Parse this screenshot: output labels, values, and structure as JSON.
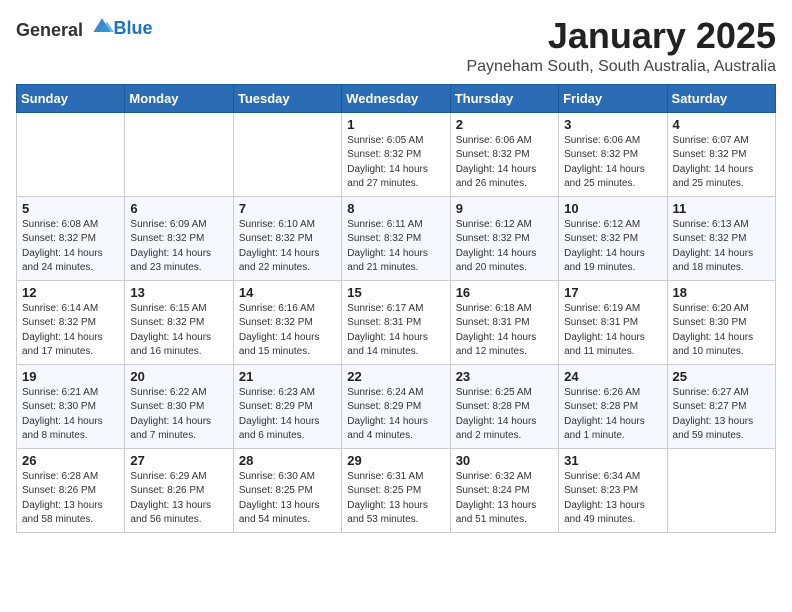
{
  "logo": {
    "general": "General",
    "blue": "Blue"
  },
  "header": {
    "month": "January 2025",
    "location": "Payneham South, South Australia, Australia"
  },
  "weekdays": [
    "Sunday",
    "Monday",
    "Tuesday",
    "Wednesday",
    "Thursday",
    "Friday",
    "Saturday"
  ],
  "weeks": [
    [
      {
        "day": "",
        "detail": ""
      },
      {
        "day": "",
        "detail": ""
      },
      {
        "day": "",
        "detail": ""
      },
      {
        "day": "1",
        "detail": "Sunrise: 6:05 AM\nSunset: 8:32 PM\nDaylight: 14 hours\nand 27 minutes."
      },
      {
        "day": "2",
        "detail": "Sunrise: 6:06 AM\nSunset: 8:32 PM\nDaylight: 14 hours\nand 26 minutes."
      },
      {
        "day": "3",
        "detail": "Sunrise: 6:06 AM\nSunset: 8:32 PM\nDaylight: 14 hours\nand 25 minutes."
      },
      {
        "day": "4",
        "detail": "Sunrise: 6:07 AM\nSunset: 8:32 PM\nDaylight: 14 hours\nand 25 minutes."
      }
    ],
    [
      {
        "day": "5",
        "detail": "Sunrise: 6:08 AM\nSunset: 8:32 PM\nDaylight: 14 hours\nand 24 minutes."
      },
      {
        "day": "6",
        "detail": "Sunrise: 6:09 AM\nSunset: 8:32 PM\nDaylight: 14 hours\nand 23 minutes."
      },
      {
        "day": "7",
        "detail": "Sunrise: 6:10 AM\nSunset: 8:32 PM\nDaylight: 14 hours\nand 22 minutes."
      },
      {
        "day": "8",
        "detail": "Sunrise: 6:11 AM\nSunset: 8:32 PM\nDaylight: 14 hours\nand 21 minutes."
      },
      {
        "day": "9",
        "detail": "Sunrise: 6:12 AM\nSunset: 8:32 PM\nDaylight: 14 hours\nand 20 minutes."
      },
      {
        "day": "10",
        "detail": "Sunrise: 6:12 AM\nSunset: 8:32 PM\nDaylight: 14 hours\nand 19 minutes."
      },
      {
        "day": "11",
        "detail": "Sunrise: 6:13 AM\nSunset: 8:32 PM\nDaylight: 14 hours\nand 18 minutes."
      }
    ],
    [
      {
        "day": "12",
        "detail": "Sunrise: 6:14 AM\nSunset: 8:32 PM\nDaylight: 14 hours\nand 17 minutes."
      },
      {
        "day": "13",
        "detail": "Sunrise: 6:15 AM\nSunset: 8:32 PM\nDaylight: 14 hours\nand 16 minutes."
      },
      {
        "day": "14",
        "detail": "Sunrise: 6:16 AM\nSunset: 8:32 PM\nDaylight: 14 hours\nand 15 minutes."
      },
      {
        "day": "15",
        "detail": "Sunrise: 6:17 AM\nSunset: 8:31 PM\nDaylight: 14 hours\nand 14 minutes."
      },
      {
        "day": "16",
        "detail": "Sunrise: 6:18 AM\nSunset: 8:31 PM\nDaylight: 14 hours\nand 12 minutes."
      },
      {
        "day": "17",
        "detail": "Sunrise: 6:19 AM\nSunset: 8:31 PM\nDaylight: 14 hours\nand 11 minutes."
      },
      {
        "day": "18",
        "detail": "Sunrise: 6:20 AM\nSunset: 8:30 PM\nDaylight: 14 hours\nand 10 minutes."
      }
    ],
    [
      {
        "day": "19",
        "detail": "Sunrise: 6:21 AM\nSunset: 8:30 PM\nDaylight: 14 hours\nand 8 minutes."
      },
      {
        "day": "20",
        "detail": "Sunrise: 6:22 AM\nSunset: 8:30 PM\nDaylight: 14 hours\nand 7 minutes."
      },
      {
        "day": "21",
        "detail": "Sunrise: 6:23 AM\nSunset: 8:29 PM\nDaylight: 14 hours\nand 6 minutes."
      },
      {
        "day": "22",
        "detail": "Sunrise: 6:24 AM\nSunset: 8:29 PM\nDaylight: 14 hours\nand 4 minutes."
      },
      {
        "day": "23",
        "detail": "Sunrise: 6:25 AM\nSunset: 8:28 PM\nDaylight: 14 hours\nand 2 minutes."
      },
      {
        "day": "24",
        "detail": "Sunrise: 6:26 AM\nSunset: 8:28 PM\nDaylight: 14 hours\nand 1 minute."
      },
      {
        "day": "25",
        "detail": "Sunrise: 6:27 AM\nSunset: 8:27 PM\nDaylight: 13 hours\nand 59 minutes."
      }
    ],
    [
      {
        "day": "26",
        "detail": "Sunrise: 6:28 AM\nSunset: 8:26 PM\nDaylight: 13 hours\nand 58 minutes."
      },
      {
        "day": "27",
        "detail": "Sunrise: 6:29 AM\nSunset: 8:26 PM\nDaylight: 13 hours\nand 56 minutes."
      },
      {
        "day": "28",
        "detail": "Sunrise: 6:30 AM\nSunset: 8:25 PM\nDaylight: 13 hours\nand 54 minutes."
      },
      {
        "day": "29",
        "detail": "Sunrise: 6:31 AM\nSunset: 8:25 PM\nDaylight: 13 hours\nand 53 minutes."
      },
      {
        "day": "30",
        "detail": "Sunrise: 6:32 AM\nSunset: 8:24 PM\nDaylight: 13 hours\nand 51 minutes."
      },
      {
        "day": "31",
        "detail": "Sunrise: 6:34 AM\nSunset: 8:23 PM\nDaylight: 13 hours\nand 49 minutes."
      },
      {
        "day": "",
        "detail": ""
      }
    ]
  ]
}
